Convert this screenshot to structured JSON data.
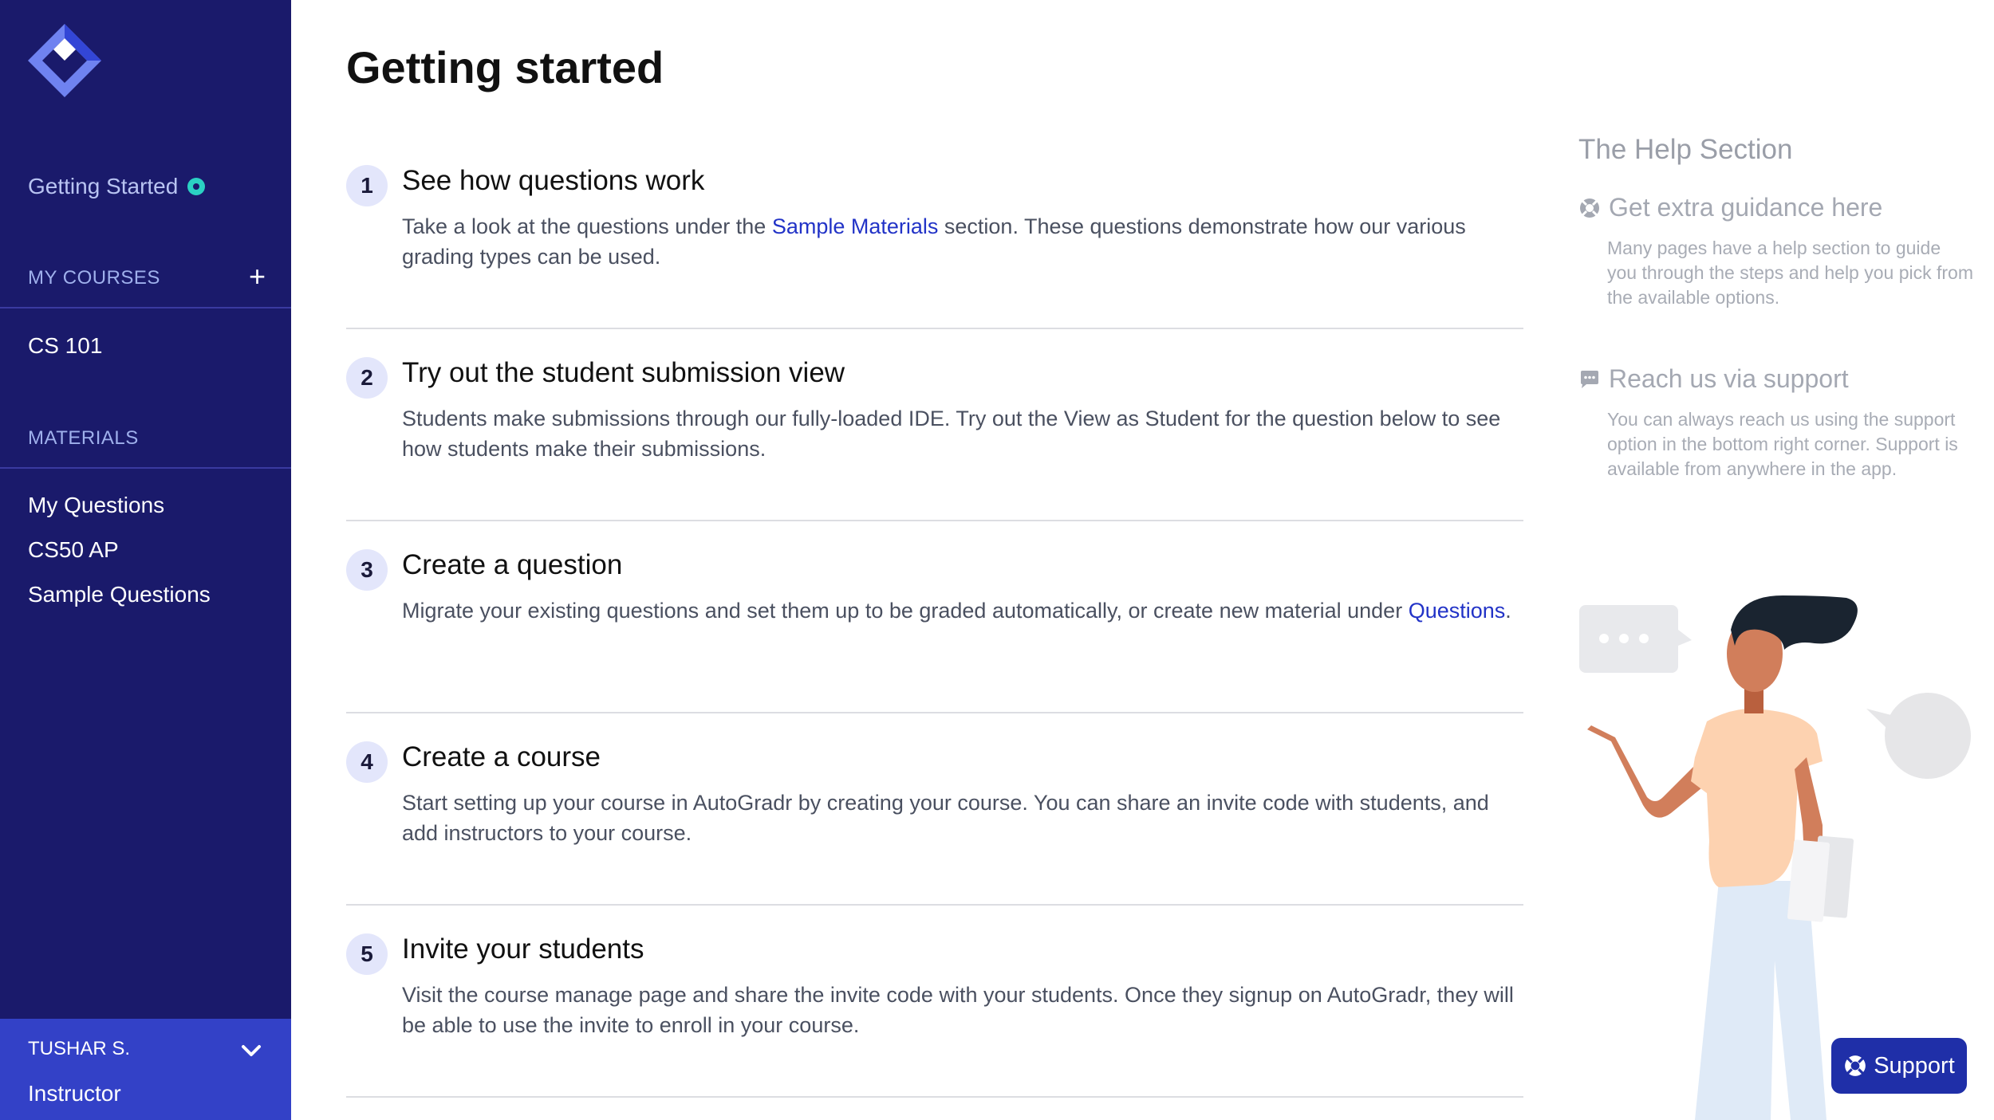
{
  "sidebar": {
    "getting_started": "Getting Started",
    "my_courses_label": "MY COURSES",
    "add_symbol": "+",
    "courses": [
      {
        "label": "CS 101"
      }
    ],
    "materials_label": "MATERIALS",
    "materials": [
      {
        "label": "My Questions"
      },
      {
        "label": "CS50 AP"
      },
      {
        "label": "Sample Questions"
      }
    ],
    "user": {
      "name": "TUSHAR S.",
      "role": "Instructor"
    }
  },
  "main": {
    "title": "Getting started",
    "steps": [
      {
        "num": "1",
        "title": "See how questions work",
        "desc_pre": "Take a look at the questions under the ",
        "link": "Sample Materials",
        "desc_post": " section. These questions demonstrate how our various grading types can be used."
      },
      {
        "num": "2",
        "title": "Try out the student submission view",
        "desc": "Students make submissions through our fully-loaded IDE. Try out the View as Student for the question below to see how students make their submissions."
      },
      {
        "num": "3",
        "title": "Create a question",
        "desc_pre": "Migrate your existing questions and set them up to be graded automatically, or create new material under ",
        "link": "Questions",
        "desc_post": "."
      },
      {
        "num": "4",
        "title": "Create a course",
        "desc": "Start setting up your course in AutoGradr by creating your course. You can share an invite code with students, and add instructors to your course."
      },
      {
        "num": "5",
        "title": "Invite your students",
        "desc": "Visit the course manage page and share the invite code with your students. Once they signup on AutoGradr, they will be able to use the invite to enroll in your course."
      }
    ]
  },
  "help": {
    "title": "The Help Section",
    "items": [
      {
        "heading": "Get extra guidance here",
        "icon": "lifebuoy-icon",
        "text": "Many pages have a help section to guide you through the steps and help you pick from the available options."
      },
      {
        "heading": "Reach us via support",
        "icon": "chat-bubble-icon",
        "text": "You can always reach us using the support option in the bottom right corner. Support is available from anywhere in the app."
      }
    ]
  },
  "support_button": {
    "label": "Support",
    "icon": "lifebuoy-icon"
  },
  "colors": {
    "sidebar": "#1a1a6b",
    "user_box": "#3341c7",
    "accent": "#2233c7",
    "status_dot": "#2bd1c3",
    "support": "#1f2fa8"
  }
}
